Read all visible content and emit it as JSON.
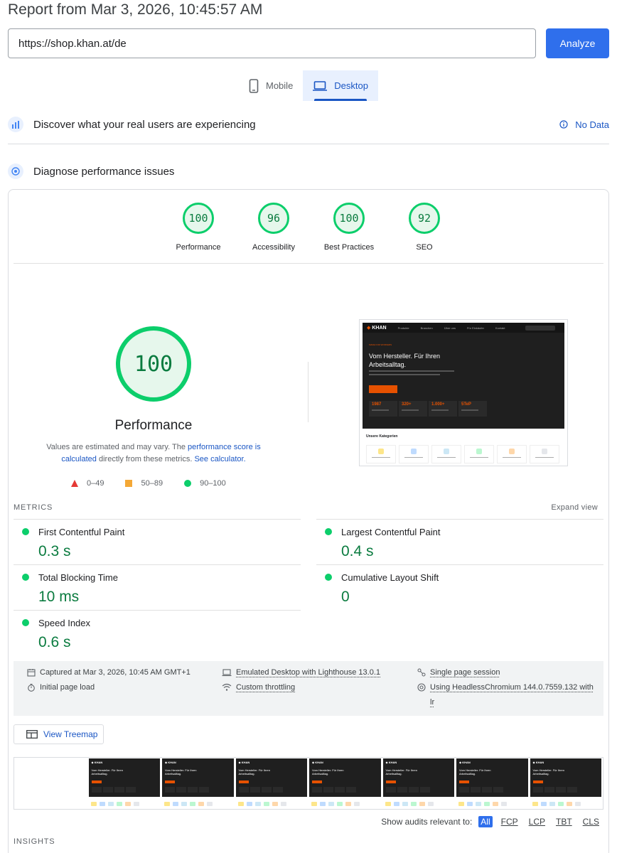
{
  "report": {
    "title": "Report from Mar 3, 2026, 10:45:57 AM"
  },
  "url_bar": {
    "value": "https://shop.khan.at/de",
    "analyze_label": "Analyze"
  },
  "device_tabs": [
    {
      "label": "Mobile",
      "icon": "smartphone-icon",
      "active": false
    },
    {
      "label": "Desktop",
      "icon": "laptop-icon",
      "active": true
    }
  ],
  "field_data": {
    "title": "Discover what your real users are experiencing",
    "status": "No Data",
    "icon": "crux-icon"
  },
  "diagnose": {
    "title": "Diagnose performance issues",
    "icon": "lighthouse-icon"
  },
  "category_scores": [
    {
      "label": "Performance",
      "score": "100"
    },
    {
      "label": "Accessibility",
      "score": "96"
    },
    {
      "label": "Best Practices",
      "score": "100"
    },
    {
      "label": "SEO",
      "score": "92"
    }
  ],
  "performance": {
    "score": "100",
    "label": "Performance",
    "note_prefix": "Values are estimated and may vary. The ",
    "note_link1": "performance score is calculated",
    "note_mid": " directly from these metrics. ",
    "note_link2": "See calculator.",
    "legend": [
      {
        "range": "0–49",
        "shape": "triangle"
      },
      {
        "range": "50–89",
        "shape": "square"
      },
      {
        "range": "90–100",
        "shape": "circle"
      }
    ]
  },
  "screenshot_preview": {
    "logo": "KHAN",
    "nav": [
      "Produkte",
      "Branchen",
      "Über uns",
      "Für Einkäufer",
      "Kontakt"
    ],
    "kicker": "MADE FOR WORKERS",
    "headline": "Vom Hersteller. Für Ihren Arbeitsalltag.",
    "stats": [
      "1987",
      "320+",
      "1.000+",
      "5TeP"
    ],
    "categories_title": "Unsere Kategorien"
  },
  "metrics": {
    "title": "METRICS",
    "expand_label": "Expand view",
    "items": [
      {
        "name": "First Contentful Paint",
        "value": "0.3 s"
      },
      {
        "name": "Largest Contentful Paint",
        "value": "0.4 s"
      },
      {
        "name": "Total Blocking Time",
        "value": "10 ms"
      },
      {
        "name": "Cumulative Layout Shift",
        "value": "0"
      },
      {
        "name": "Speed Index",
        "value": "0.6 s"
      }
    ]
  },
  "run_info": {
    "captured": "Captured at Mar 3, 2026, 10:45 AM GMT+1",
    "load": "Initial page load",
    "device": "Emulated Desktop with Lighthouse 13.0.1",
    "throttling": "Custom throttling",
    "session": "Single page session",
    "browser": "Using HeadlessChromium 144.0.7559.132 with lr"
  },
  "treemap": {
    "label": "View Treemap"
  },
  "audit_filter": {
    "label": "Show audits relevant to:",
    "options": [
      "All",
      "FCP",
      "LCP",
      "TBT",
      "CLS"
    ],
    "selected": "All"
  },
  "insights": {
    "title": "INSIGHTS"
  },
  "colors": {
    "accent": "#2f6fec",
    "pass": "#0cce6b",
    "pass_text": "#0a7b3f",
    "fail": "#e53935",
    "average": "#f4a836",
    "link": "#1a56c4"
  }
}
